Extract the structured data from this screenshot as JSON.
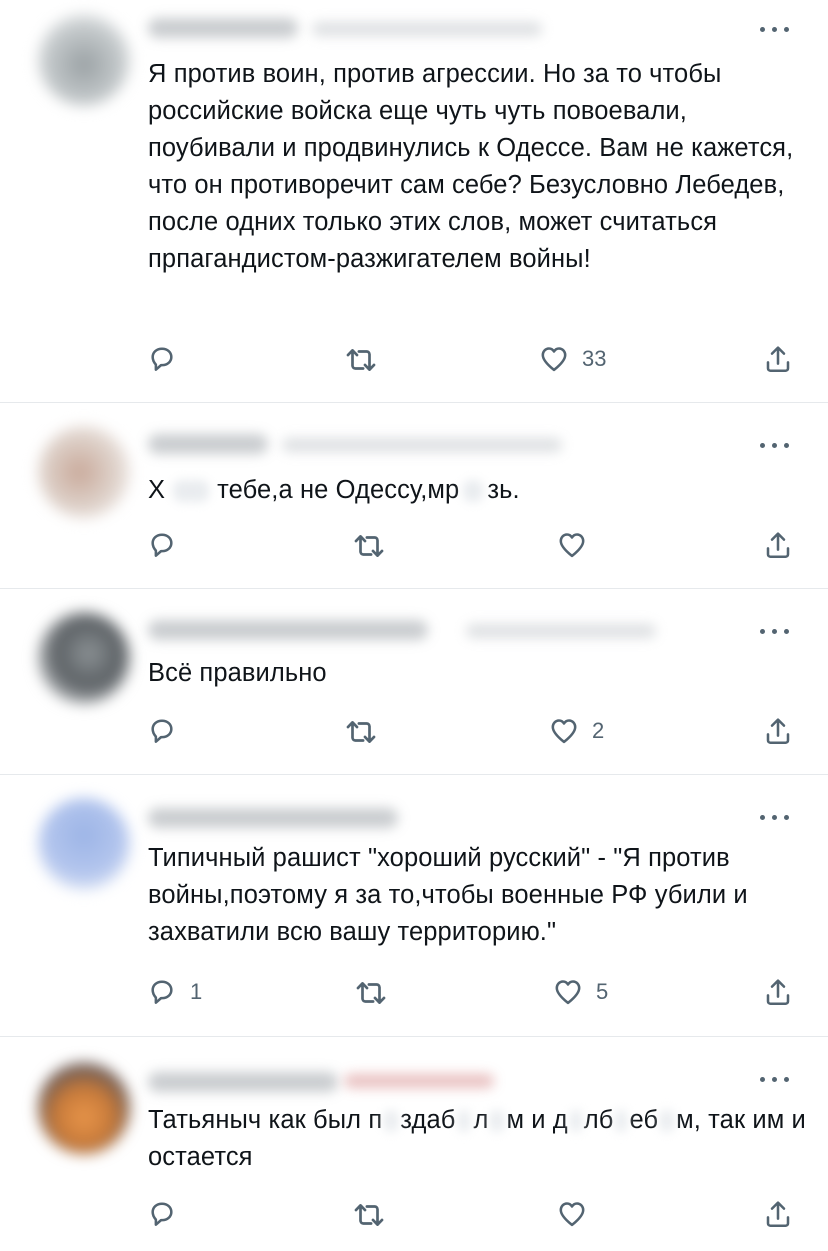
{
  "tweets": [
    {
      "text": "Я против воин, против агрессии. Но за то чтобы российские войска еще чуть чуть повоевали, поубивали и продвинулись к Одессе. Вам не кажется, что он противоречит сам себе? Безусловно Лебедев, после одних только этих слов, может считаться прпагандистом-разжигателем войны!",
      "reply_count": "",
      "retweet_count": "",
      "like_count": "33"
    },
    {
      "text_parts": [
        "Х",
        "тебе,а не Одессу,мр",
        "зь."
      ],
      "reply_count": "",
      "retweet_count": "",
      "like_count": ""
    },
    {
      "text": "Всё правильно",
      "reply_count": "",
      "retweet_count": "",
      "like_count": "2"
    },
    {
      "text": "Типичный рашист \"хороший русский\" - \"Я против войны,поэтому я за то,чтобы военные РФ убили и захватили всю вашу территорию.\"",
      "reply_count": "1",
      "retweet_count": "",
      "like_count": "5"
    },
    {
      "text_parts": [
        "Татьяныч как был п",
        "здаб",
        "л",
        "м и д",
        "лб",
        "еб",
        "м, так им и остается"
      ],
      "reply_count": "",
      "retweet_count": "",
      "like_count": ""
    }
  ],
  "icons": {
    "reply": "reply-icon",
    "retweet": "retweet-icon",
    "like": "heart-icon",
    "share": "share-icon",
    "more": "more-icon"
  },
  "colors": {
    "text": "#0f1419",
    "icon": "#536471",
    "divider": "#e6e9ec"
  }
}
